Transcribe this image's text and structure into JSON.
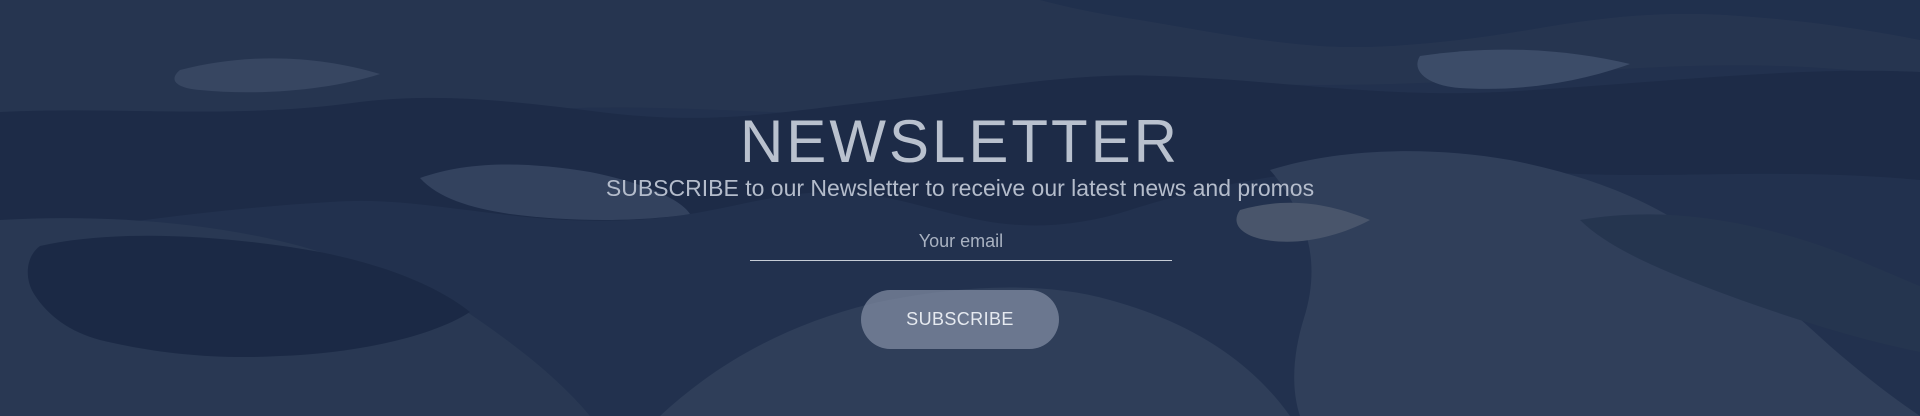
{
  "newsletter": {
    "title": "NEWSLETTER",
    "subtitle": "SUBSCRIBE to our Newsletter to receive our latest news and promos",
    "email": {
      "value": "",
      "placeholder": "Your email"
    },
    "subscribe_label": "SUBSCRIBE"
  },
  "colors": {
    "overlay_navy": "#1e2c4d",
    "title_text": "#b9c1ce",
    "button_fill": "#8994aa"
  }
}
